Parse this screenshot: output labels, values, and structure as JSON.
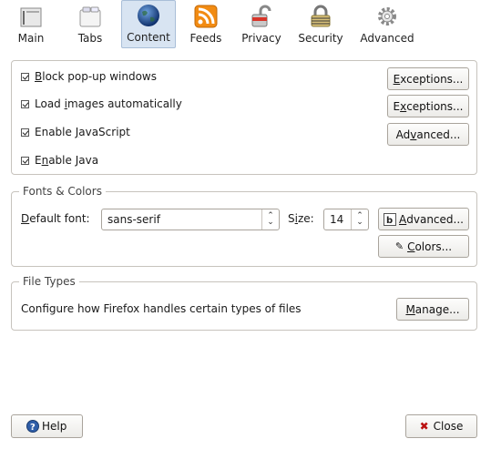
{
  "toolbar": {
    "items": [
      {
        "label": "Main",
        "icon": "main-icon"
      },
      {
        "label": "Tabs",
        "icon": "tabs-icon"
      },
      {
        "label": "Content",
        "icon": "globe-icon"
      },
      {
        "label": "Feeds",
        "icon": "rss-icon"
      },
      {
        "label": "Privacy",
        "icon": "lock-icon"
      },
      {
        "label": "Security",
        "icon": "security-lock-icon"
      },
      {
        "label": "Advanced",
        "icon": "gear-icon"
      }
    ],
    "active": "Content"
  },
  "content": {
    "block_popups": {
      "pre": "",
      "acc": "B",
      "post": "lock pop-up windows",
      "checked": true
    },
    "load_images": {
      "pre": "Load ",
      "acc": "i",
      "post": "mages automatically",
      "checked": true
    },
    "enable_js": {
      "pre": "Enable ",
      "acc": "J",
      "post": "avaScript",
      "checked": true
    },
    "enable_java": {
      "pre": "E",
      "acc": "n",
      "post": "able Java",
      "checked": true
    },
    "exceptions1": {
      "pre": "",
      "acc": "E",
      "post": "xceptions..."
    },
    "exceptions2": {
      "pre": "E",
      "acc": "x",
      "post": "ceptions..."
    },
    "advanced_js": {
      "pre": "Ad",
      "acc": "v",
      "post": "anced..."
    }
  },
  "fonts": {
    "legend": "Fonts & Colors",
    "default_font_label": {
      "pre": "",
      "acc": "D",
      "post": "efault font:"
    },
    "default_font_value": "sans-serif",
    "size_label": {
      "pre": "S",
      "acc": "i",
      "post": "ze:"
    },
    "size_value": "14",
    "advanced": {
      "pre": "",
      "acc": "A",
      "post": "dvanced..."
    },
    "colors": {
      "pre": "",
      "acc": "C",
      "post": "olors..."
    }
  },
  "filetypes": {
    "legend": "File Types",
    "description": "Configure how Firefox handles certain types of files",
    "manage": {
      "pre": "",
      "acc": "M",
      "post": "anage..."
    }
  },
  "footer": {
    "help": "Help",
    "close": "Close"
  }
}
